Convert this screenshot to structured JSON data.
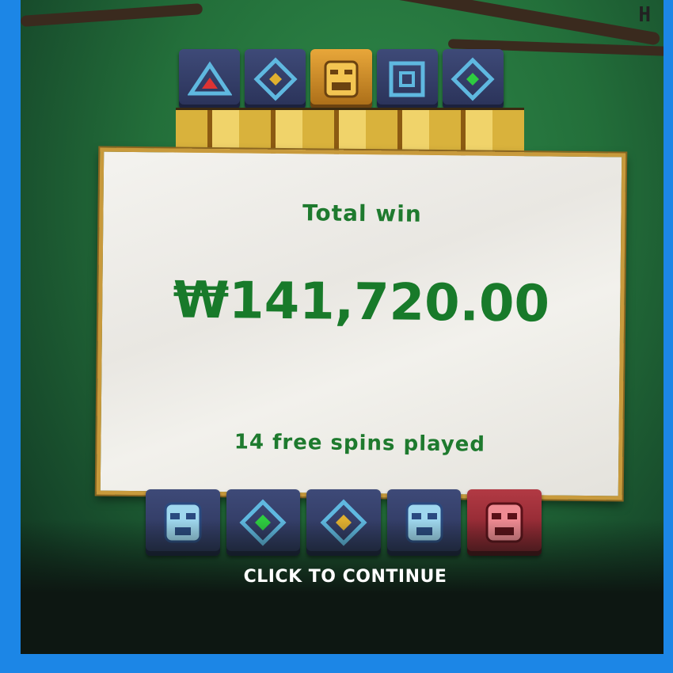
{
  "game": {
    "logo_text": "H",
    "top_reel": [
      "triangle-symbol",
      "diamond-gold-symbol",
      "gold-mask-symbol",
      "square-symbol",
      "diamond-green-symbol"
    ],
    "bottom_reel": [
      "blue-mask-symbol",
      "diamond-green-symbol",
      "diamond-gold-symbol",
      "blue-mask-symbol",
      "red-mask-symbol"
    ]
  },
  "win_panel": {
    "title": "Total win",
    "amount": "₩141,720.00",
    "free_spins_text": "14 free spins played"
  },
  "continue_label": "CLICK TO CONTINUE",
  "colors": {
    "accent_green": "#1e7a2e",
    "panel_border": "#c89a3c",
    "tile_blue": "#3e4a78",
    "tile_red": "#b23a44"
  }
}
